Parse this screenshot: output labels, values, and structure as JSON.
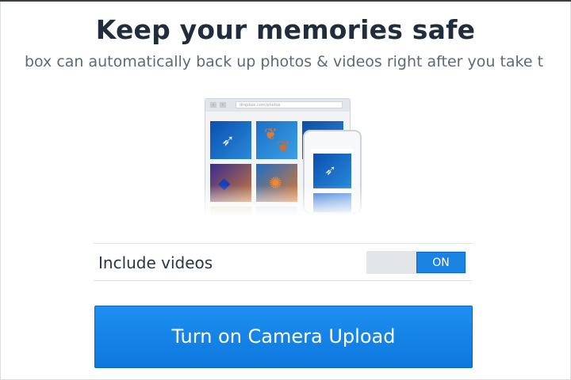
{
  "header": {
    "title": "Keep your memories safe",
    "subtitle": "box can automatically back up photos & videos right after you take t"
  },
  "illustration": {
    "browser_url": "dropbox.com/photos",
    "nav_back": "‹",
    "nav_forward": "›",
    "icons": [
      "fish-photo-icon",
      "jellyfish-photo-icon",
      "coral-reef-photo-icon",
      "orange-fish-photo-icon"
    ]
  },
  "settings": {
    "include_videos_label": "Include videos",
    "include_videos_state": "ON"
  },
  "cta": {
    "label": "Turn on Camera Upload"
  },
  "colors": {
    "accent": "#1a82e2",
    "title": "#1f2d3d",
    "subtitle": "#5f6a76"
  }
}
